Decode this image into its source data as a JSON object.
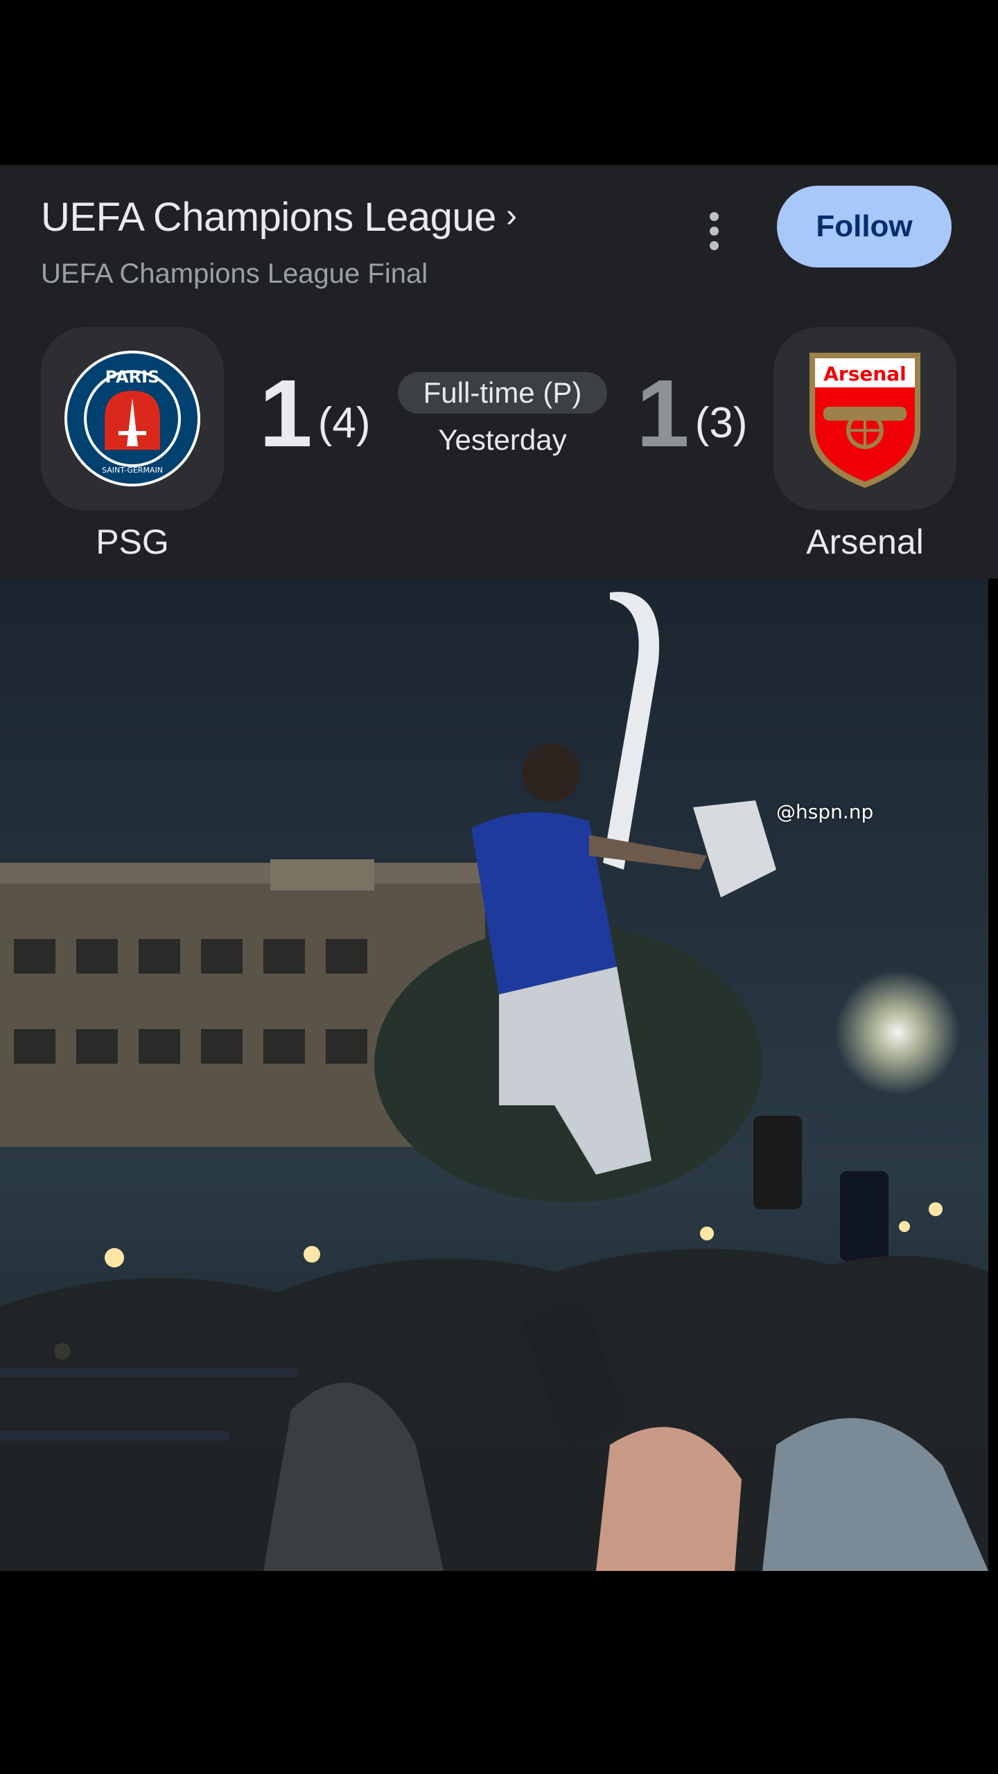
{
  "header": {
    "league_title": "UEFA Champions League",
    "league_chevron": "›",
    "league_subtitle": "UEFA Champions League Final",
    "more_icon": "more-vert-icon",
    "follow_label": "Follow"
  },
  "match": {
    "home": {
      "name": "PSG",
      "score": "1",
      "penalties": "(4)",
      "crest_text": "PARIS",
      "crest_subtext": "SAINT-GERMAIN"
    },
    "away": {
      "name": "Arsenal",
      "score": "1",
      "penalties": "(3)",
      "crest_text": "Arsenal"
    },
    "status": "Full-time (P)",
    "date": "Yesterday"
  },
  "video": {
    "watermark": "@hspn.np"
  },
  "colors": {
    "card_bg": "#202124",
    "follow_bg": "#a8c7fa",
    "psg_blue": "#004170",
    "psg_red": "#da291c",
    "arsenal_red": "#ef0107",
    "arsenal_gold": "#9c824a"
  }
}
